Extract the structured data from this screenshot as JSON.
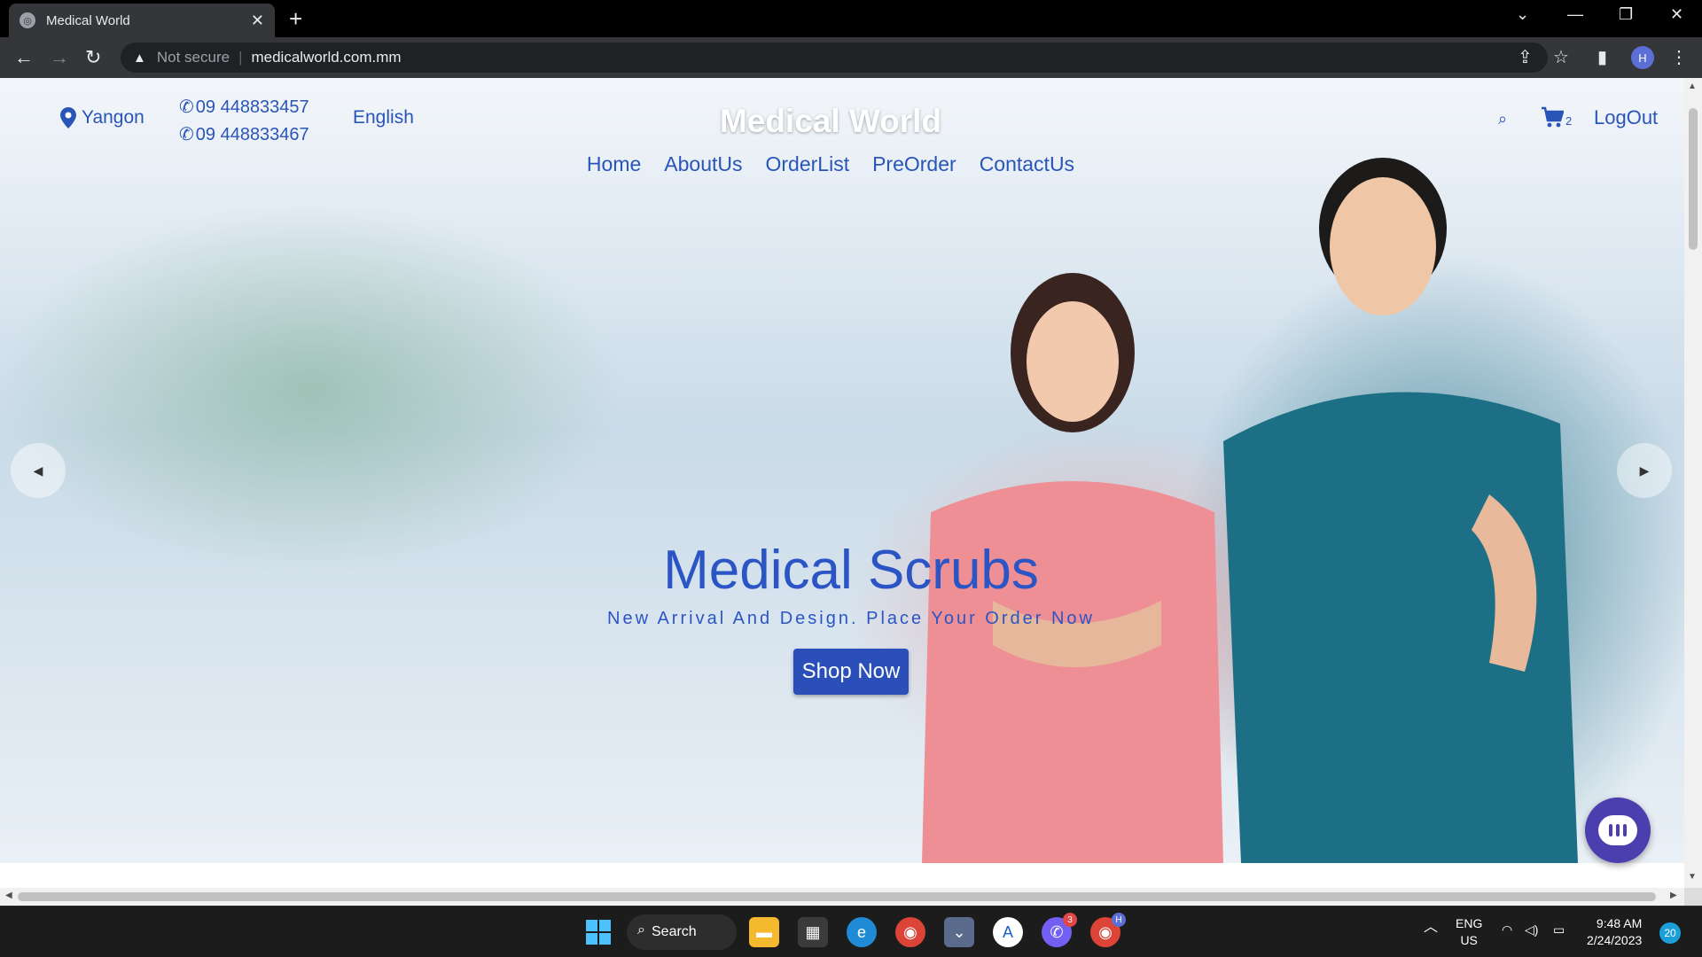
{
  "browser": {
    "tab_title": "Medical World",
    "security_label": "Not secure",
    "url": "medicalworld.com.mm",
    "profile_initial": "H"
  },
  "header": {
    "location": "Yangon",
    "phone_1": "09 448833457",
    "phone_2": "09 448833467",
    "language": "English",
    "brand": "Medical World",
    "cart_count": "2",
    "logout": "LogOut"
  },
  "nav": {
    "items": [
      "Home",
      "AboutUs",
      "OrderList",
      "PreOrder",
      "ContactUs"
    ]
  },
  "hero": {
    "title": "Medical Scrubs",
    "subtitle": "New Arrival And Design. Place Your Order Now",
    "cta": "Shop Now"
  },
  "taskbar": {
    "search_label": "Search",
    "viber_badge": "3",
    "chrome_profile": "H",
    "lang_line1": "ENG",
    "lang_line2": "US",
    "time": "9:48 AM",
    "date": "2/24/2023",
    "notifications": "20"
  },
  "colors": {
    "accent": "#2a55b8",
    "button": "#2a4fb8",
    "chat_fab": "#4b3fb0"
  }
}
